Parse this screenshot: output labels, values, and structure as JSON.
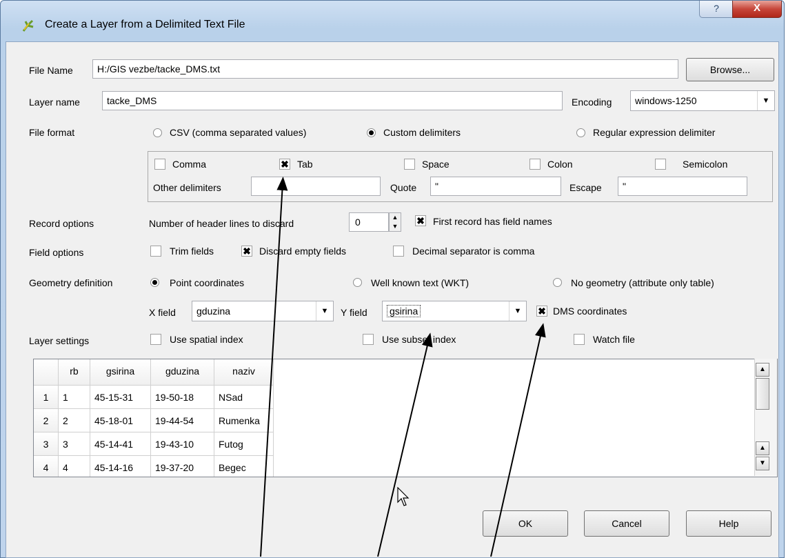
{
  "window": {
    "title": "Create a Layer from a Delimited Text File",
    "help_btn": "?",
    "close_btn": "X"
  },
  "file_name": {
    "label": "File Name",
    "value": "H:/GIS vezbe/tacke_DMS.txt",
    "browse": "Browse..."
  },
  "layer_name": {
    "label": "Layer name",
    "value": "tacke_DMS"
  },
  "encoding": {
    "label": "Encoding",
    "value": "windows-1250"
  },
  "file_format": {
    "label": "File format",
    "options": [
      "CSV (comma separated values)",
      "Custom delimiters",
      "Regular expression delimiter"
    ],
    "selected": "Custom delimiters"
  },
  "delimiters": {
    "comma": "Comma",
    "tab": "Tab",
    "space": "Space",
    "colon": "Colon",
    "semicolon": "Semicolon",
    "other_label": "Other delimiters",
    "other_value": "",
    "quote_label": "Quote",
    "quote_value": "\"",
    "escape_label": "Escape",
    "escape_value": "\""
  },
  "record_options": {
    "label": "Record options",
    "header_lines_label": "Number of header lines to discard",
    "header_lines_value": "0",
    "first_record": "First record has field names"
  },
  "field_options": {
    "label": "Field options",
    "trim": "Trim fields",
    "discard_empty": "Discard empty fields",
    "decimal_comma": "Decimal separator is comma"
  },
  "geometry": {
    "label": "Geometry definition",
    "point": "Point coordinates",
    "wkt": "Well known text (WKT)",
    "none": "No geometry (attribute only table)",
    "x_label": "X field",
    "x_value": "gduzina",
    "y_label": "Y field",
    "y_value": "gsirina",
    "dms": "DMS coordinates"
  },
  "layer_settings": {
    "label": "Layer settings",
    "spatial_index": "Use spatial index",
    "subset_index": "Use subset index",
    "watch_file": "Watch file"
  },
  "table": {
    "headers": [
      "rb",
      "gsirina",
      "gduzina",
      "naziv"
    ],
    "rows": [
      {
        "num": "1",
        "cells": [
          "1",
          "45-15-31",
          "19-50-18",
          "NSad"
        ]
      },
      {
        "num": "2",
        "cells": [
          "2",
          "45-18-01",
          "19-44-54",
          "Rumenka"
        ]
      },
      {
        "num": "3",
        "cells": [
          "3",
          "45-14-41",
          "19-43-10",
          "Futog"
        ]
      },
      {
        "num": "4",
        "cells": [
          "4",
          "45-14-16",
          "19-37-20",
          "Begec"
        ]
      }
    ]
  },
  "buttons": {
    "ok": "OK",
    "cancel": "Cancel",
    "help": "Help"
  }
}
